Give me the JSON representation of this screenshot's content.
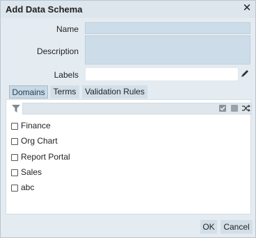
{
  "dialog": {
    "title": "Add Data Schema",
    "close_glyph": "✕"
  },
  "form": {
    "name_label": "Name",
    "name_value": "",
    "description_label": "Description",
    "description_value": "",
    "labels_label": "Labels",
    "labels_value": ""
  },
  "tabs": [
    {
      "label": "Domains",
      "active": true
    },
    {
      "label": "Terms",
      "active": false
    },
    {
      "label": "Validation Rules",
      "active": false
    }
  ],
  "filter": {
    "value": "",
    "icons": [
      "filter-icon",
      "select-all-icon",
      "deselect-all-icon",
      "shuffle-icon"
    ]
  },
  "domains": [
    {
      "label": "Finance",
      "checked": false
    },
    {
      "label": "Org Chart",
      "checked": false
    },
    {
      "label": "Report Portal",
      "checked": false
    },
    {
      "label": "Sales",
      "checked": false
    },
    {
      "label": "abc",
      "checked": false
    }
  ],
  "buttons": {
    "ok": "OK",
    "cancel": "Cancel"
  },
  "colors": {
    "dialog_bg": "#e4ebf1",
    "field_bg": "#ccdce8",
    "tab_bg": "#d3dfe8",
    "active_tab_border": "#a8bccb"
  }
}
